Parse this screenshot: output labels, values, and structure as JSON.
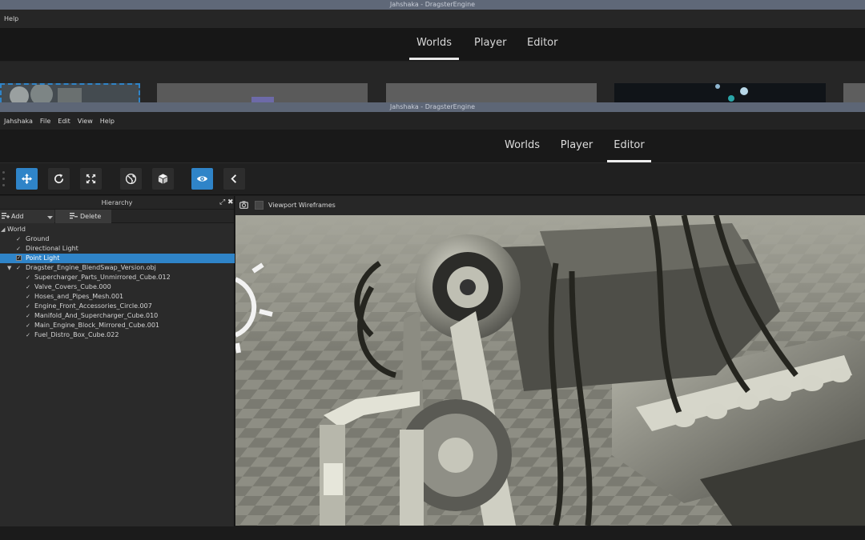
{
  "background_window": {
    "title": "Jahshaka - DragsterEngine",
    "menu": [
      "Help"
    ],
    "tabs": [
      {
        "label": "Worlds",
        "active": true
      },
      {
        "label": "Player",
        "active": false
      },
      {
        "label": "Editor",
        "active": false
      }
    ]
  },
  "window": {
    "title": "Jahshaka - DragsterEngine",
    "menu": [
      "Jahshaka",
      "File",
      "Edit",
      "View",
      "Help"
    ],
    "tabs": [
      {
        "label": "Worlds",
        "active": false
      },
      {
        "label": "Player",
        "active": false
      },
      {
        "label": "Editor",
        "active": true
      }
    ]
  },
  "toolbar": {
    "tools": [
      {
        "icon": "move-icon",
        "active": true
      },
      {
        "icon": "rotate-icon",
        "active": false
      },
      {
        "icon": "scale-icon",
        "active": false
      },
      {
        "icon": "globe-icon",
        "active": false
      },
      {
        "icon": "cube-icon",
        "active": false
      },
      {
        "icon": "eye-icon",
        "active": true
      },
      {
        "icon": "chevron-left-icon",
        "active": false
      }
    ],
    "accent_color": "#2f84c8"
  },
  "hierarchy": {
    "title": "Hierarchy",
    "add_label": "Add",
    "delete_label": "Delete",
    "items": [
      {
        "label": "World",
        "level": 0,
        "expander": "down",
        "check": ""
      },
      {
        "label": "Ground",
        "level": 1,
        "check": "✓"
      },
      {
        "label": "Directional Light",
        "level": 1,
        "check": "✓"
      },
      {
        "label": "Point Light",
        "level": 1,
        "check": "✓",
        "selected": true
      },
      {
        "label": "Dragster_Engine_BlendSwap_Version.obj",
        "level": 1,
        "expander": "down",
        "check": "✓"
      },
      {
        "label": "Supercharger_Parts_Unmirrored_Cube.012",
        "level": 2,
        "check": "✓"
      },
      {
        "label": "Valve_Covers_Cube.000",
        "level": 2,
        "check": "✓"
      },
      {
        "label": "Hoses_and_Pipes_Mesh.001",
        "level": 2,
        "check": "✓"
      },
      {
        "label": "Engine_Front_Accessories_Circle.007",
        "level": 2,
        "check": "✓"
      },
      {
        "label": "Manifold_And_Supercharger_Cube.010",
        "level": 2,
        "check": "✓"
      },
      {
        "label": "Main_Engine_Block_Mirrored_Cube.001",
        "level": 2,
        "check": "✓"
      },
      {
        "label": "Fuel_Distro_Box_Cube.022",
        "level": 2,
        "check": "✓"
      }
    ]
  },
  "viewport": {
    "wireframes_label": "Viewport Wireframes",
    "wireframes_checked": false
  }
}
